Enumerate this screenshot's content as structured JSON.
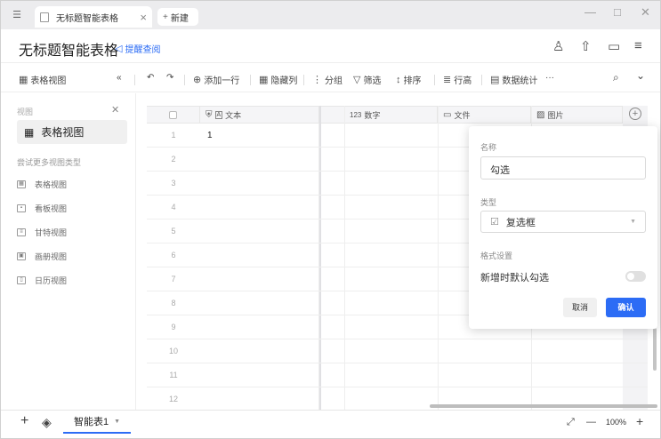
{
  "tabbar": {
    "menu_icon": "☰",
    "active_tab": "无标题智能表格",
    "close_glyph": "×",
    "new_tab": "新建",
    "new_tab_icon": "+",
    "minimize": "—",
    "maximize": "□",
    "close_window": "✕"
  },
  "header": {
    "title": "无标题智能表格",
    "remind_label": "提醒查阅",
    "remind_icon": "◁",
    "add_user_icon": "♙",
    "share_icon": "⇧",
    "comment_icon": "▭",
    "menu_icon": "≡"
  },
  "toolbar": {
    "view_icon": "▦",
    "view_name": "表格视图",
    "collapse": "«",
    "undo": "↶",
    "redo": "↷",
    "add_row_icon": "⊕",
    "add_row": "添加一行",
    "hide_col_icon": "▦",
    "hide_col": "隐藏列",
    "group_icon": "⋮",
    "group": "分组",
    "filter_icon": "▽",
    "filter": "筛选",
    "sort_icon": "↕",
    "sort": "排序",
    "row_height_icon": "≣",
    "row_height": "行高",
    "stats_icon": "▤",
    "stats": "数据统计",
    "more": "···",
    "search_icon": "⌕",
    "expand_icon": "⌄"
  },
  "sidebar": {
    "views_label": "视图",
    "pin_icon": "✕",
    "active_view_icon": "▦",
    "active_view": "表格视图",
    "more_types_label": "尝试更多视图类型",
    "view_types": [
      {
        "label": "表格视图",
        "icon": "▦"
      },
      {
        "label": "看板视图",
        "icon": "▪"
      },
      {
        "label": "甘特视图",
        "icon": "≡"
      },
      {
        "label": "画册视图",
        "icon": "▣"
      },
      {
        "label": "日历视图",
        "icon": "▯"
      }
    ]
  },
  "grid": {
    "columns": [
      {
        "icon": "A",
        "label": "文本",
        "lock": "⛨"
      },
      {
        "icon": "123",
        "label": "数字"
      },
      {
        "icon": "▭",
        "label": "文件"
      },
      {
        "icon": "▨",
        "label": "图片"
      }
    ],
    "add_col_icon": "+",
    "rows": [
      {
        "num": "1",
        "text": "1"
      },
      {
        "num": "2",
        "text": ""
      },
      {
        "num": "3",
        "text": ""
      },
      {
        "num": "4",
        "text": ""
      },
      {
        "num": "5",
        "text": ""
      },
      {
        "num": "6",
        "text": ""
      },
      {
        "num": "7",
        "text": ""
      },
      {
        "num": "8",
        "text": ""
      },
      {
        "num": "9",
        "text": ""
      },
      {
        "num": "10",
        "text": ""
      },
      {
        "num": "11",
        "text": ""
      },
      {
        "num": "12",
        "text": ""
      }
    ]
  },
  "popup": {
    "name_label": "名称",
    "name_value": "勾选",
    "type_label": "类型",
    "type_icon": "☑",
    "type_value": "复选框",
    "type_chevron": "▼",
    "format_label": "格式设置",
    "default_check_label": "新增时默认勾选",
    "default_check_value": false,
    "cancel": "取消",
    "confirm": "确认"
  },
  "bottombar": {
    "add_icon": "+",
    "layers_icon": "◈",
    "sheet_name": "智能表1",
    "sheet_chevron": "▼",
    "fit_icon": "⤢",
    "zoom_out": "—",
    "zoom": "100%",
    "zoom_in": "+"
  },
  "colors": {
    "accent": "#2c6cf5"
  }
}
